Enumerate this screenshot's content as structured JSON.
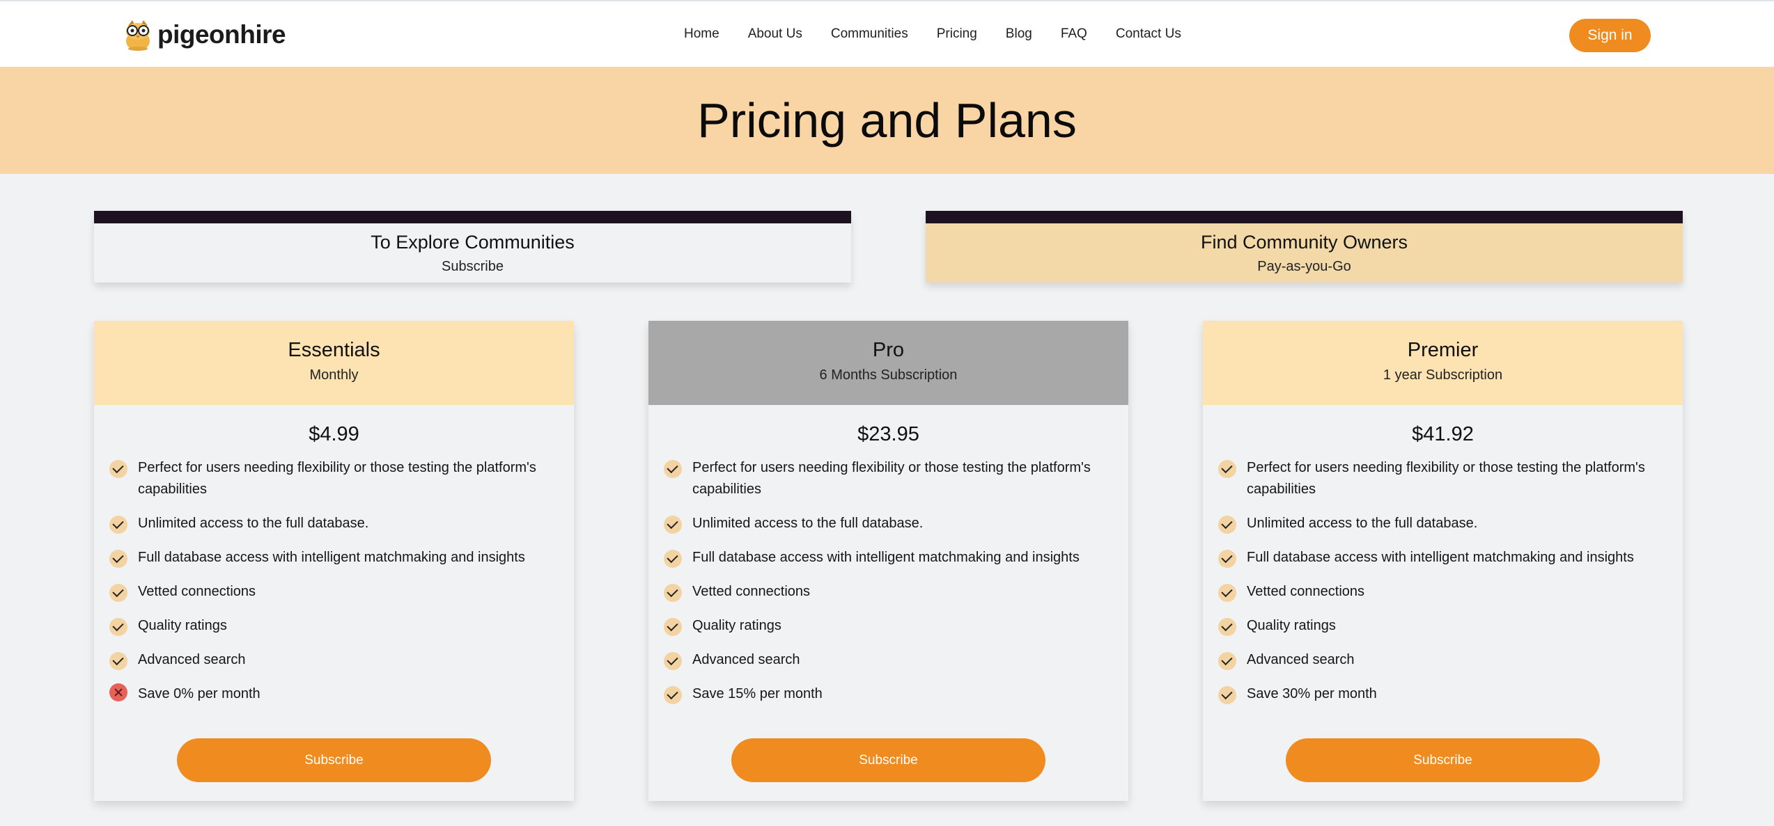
{
  "brand": {
    "name": "pigeonhire",
    "logo_icon": "owl-logo-icon"
  },
  "nav": {
    "links": [
      "Home",
      "About Us",
      "Communities",
      "Pricing",
      "Blog",
      "FAQ",
      "Contact Us"
    ],
    "sign_in_label": "Sign in"
  },
  "banner": {
    "title": "Pricing and Plans"
  },
  "tabs": [
    {
      "title": "To Explore Communities",
      "subtitle": "Subscribe"
    },
    {
      "title": "Find Community Owners",
      "subtitle": "Pay-as-you-Go"
    }
  ],
  "plans": [
    {
      "name": "Essentials",
      "period": "Monthly",
      "price": "$4.99",
      "header_color": "#fde3b2",
      "features": [
        {
          "text": "Perfect for users needing flexibility or those testing the platform's capabilities",
          "icon": "check-icon"
        },
        {
          "text": "Unlimited access to the full database.",
          "icon": "check-icon"
        },
        {
          "text": "Full database access with intelligent matchmaking and insights",
          "icon": "check-icon"
        },
        {
          "text": "Vetted connections",
          "icon": "check-icon"
        },
        {
          "text": "Quality ratings",
          "icon": "check-icon"
        },
        {
          "text": "Advanced search",
          "icon": "check-icon"
        },
        {
          "text": "Save 0% per month",
          "icon": "cross-icon"
        }
      ],
      "button_label": "Subscribe"
    },
    {
      "name": "Pro",
      "period": "6 Months Subscription",
      "price": "$23.95",
      "header_color": "#a8a8a8",
      "features": [
        {
          "text": "Perfect for users needing flexibility or those testing the platform's capabilities",
          "icon": "check-icon"
        },
        {
          "text": "Unlimited access to the full database.",
          "icon": "check-icon"
        },
        {
          "text": "Full database access with intelligent matchmaking and insights",
          "icon": "check-icon"
        },
        {
          "text": "Vetted connections",
          "icon": "check-icon"
        },
        {
          "text": "Quality ratings",
          "icon": "check-icon"
        },
        {
          "text": "Advanced search",
          "icon": "check-icon"
        },
        {
          "text": "Save 15% per month",
          "icon": "check-icon"
        }
      ],
      "button_label": "Subscribe"
    },
    {
      "name": "Premier",
      "period": "1 year Subscription",
      "price": "$41.92",
      "header_color": "#fde3b2",
      "features": [
        {
          "text": "Perfect for users needing flexibility or those testing the platform's capabilities",
          "icon": "check-icon"
        },
        {
          "text": "Unlimited access to the full database.",
          "icon": "check-icon"
        },
        {
          "text": "Full database access with intelligent matchmaking and insights",
          "icon": "check-icon"
        },
        {
          "text": "Vetted connections",
          "icon": "check-icon"
        },
        {
          "text": "Quality ratings",
          "icon": "check-icon"
        },
        {
          "text": "Advanced search",
          "icon": "check-icon"
        },
        {
          "text": "Save 30% per month",
          "icon": "check-icon"
        }
      ],
      "button_label": "Subscribe"
    }
  ],
  "colors": {
    "accent": "#ef8b1f",
    "banner": "#f9d4a4",
    "dark_bar": "#1e1221",
    "check_bg": "#f3d3a2",
    "cross_bg": "#e9605a"
  }
}
